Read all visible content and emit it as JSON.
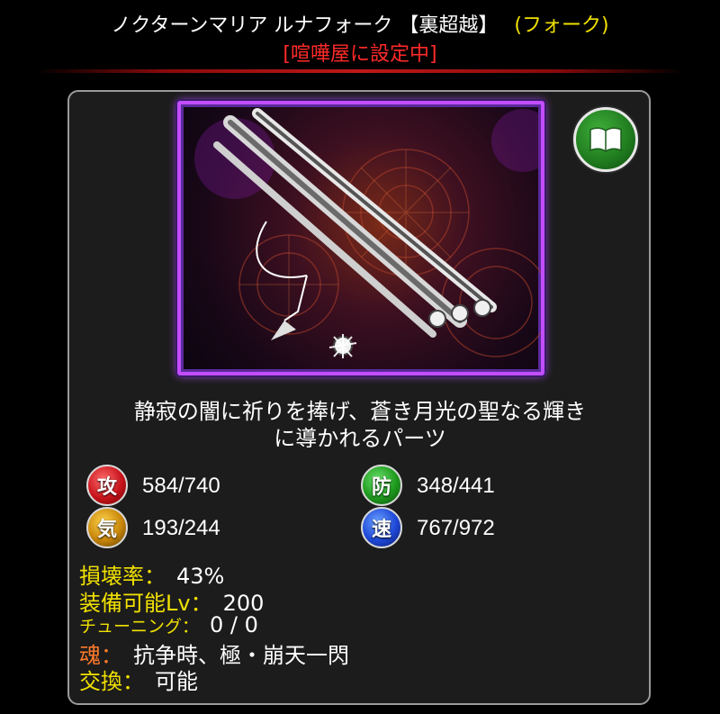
{
  "header": {
    "item_name": "ノクターンマリア ルナフォーク 【裏超越】",
    "item_type": "(フォーク)",
    "status": "[喧嘩屋に設定中]"
  },
  "panel": {
    "description_line1": "静寂の闇に祈りを捧げ、蒼き月光の聖なる輝き",
    "description_line2": "に導かれるパーツ",
    "stats": {
      "attack": {
        "icon": "攻",
        "value": "584/740"
      },
      "defense": {
        "icon": "防",
        "value": "348/441"
      },
      "spirit": {
        "icon": "気",
        "value": "193/244"
      },
      "speed": {
        "icon": "速",
        "value": "767/972"
      }
    },
    "info": {
      "damage_label": "損壊率：",
      "damage_value": "43%",
      "equip_label": "装備可能Lv：",
      "equip_value": "200",
      "tuning_label": "チューニング：",
      "tuning_value": "0 / 0",
      "soul_label": "魂：",
      "soul_value": "抗争時、極・崩天一閃",
      "trade_label": "交換：",
      "trade_value": "可能"
    }
  },
  "colors": {
    "status_red": "#ff2a2a",
    "type_yellow": "#f0e000",
    "label_orange": "#ff7a2a",
    "frame_purple": "#c24dff"
  },
  "icons": {
    "book": "open-book-icon",
    "artwork": "crossbow-weapon-art"
  }
}
